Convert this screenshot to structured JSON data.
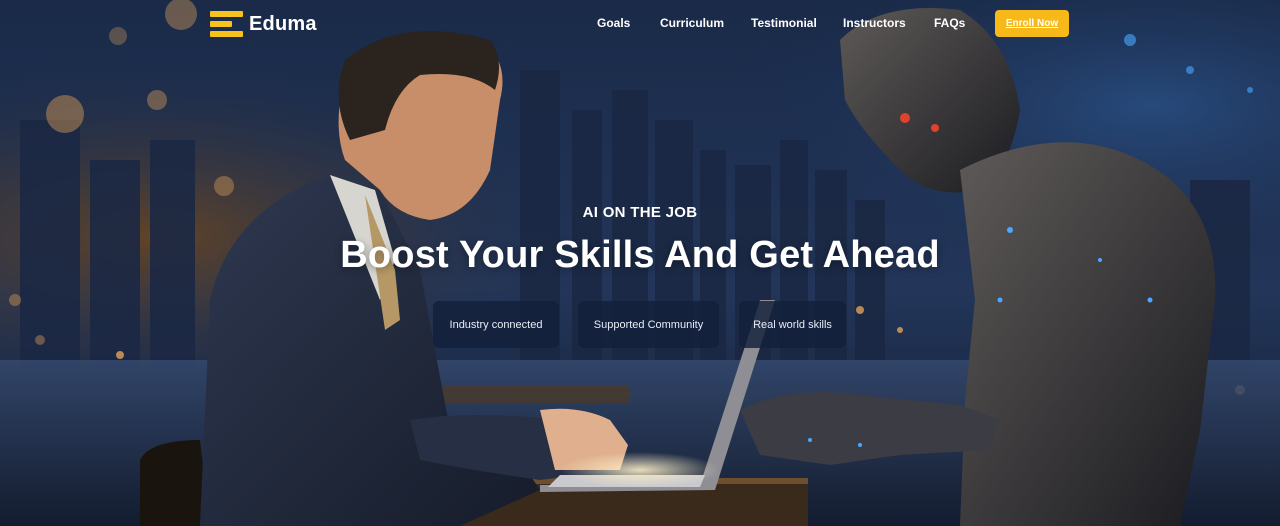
{
  "brand": {
    "name": "Eduma",
    "icon": "menu-bars-logo-icon",
    "accent": "#f7c21b"
  },
  "nav": {
    "links": [
      "Goals",
      "Curriculum",
      "Testimonial",
      "Instructors",
      "FAQs"
    ],
    "cta_label": "Enroll Now",
    "cta_color": "#f7b91a"
  },
  "hero": {
    "eyebrow": "AI ON THE JOB",
    "headline": "Boost Your Skills And Get Ahead",
    "features": [
      "Industry connected",
      "Supported Community",
      "Real world skills"
    ],
    "background_description_icon": "businessman-and-robot-illustration"
  }
}
